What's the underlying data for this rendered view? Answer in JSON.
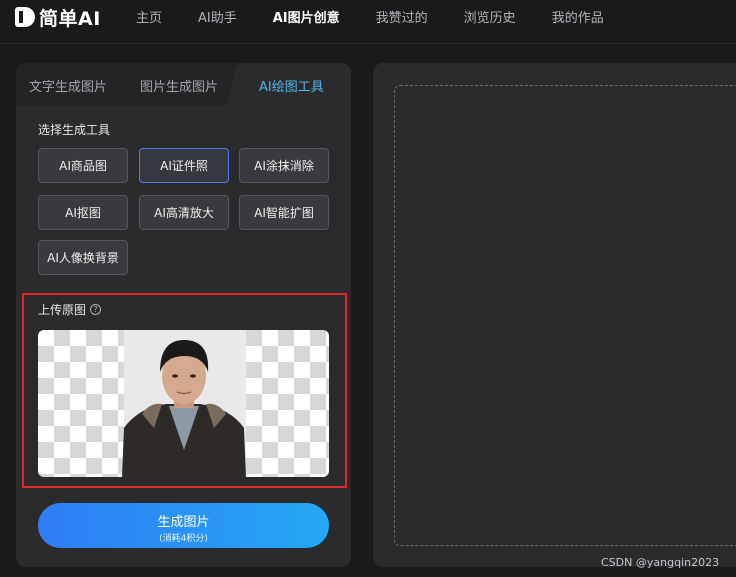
{
  "logo": {
    "text": "简单AI"
  },
  "nav": [
    "主页",
    "AI助手",
    "AI图片创意",
    "我赞过的",
    "浏览历史",
    "我的作品"
  ],
  "nav_active": "AI图片创意",
  "tabs": [
    "文字生成图片",
    "图片生成图片",
    "AI绘图工具"
  ],
  "tabs_active": "AI绘图工具",
  "tool_section_label": "选择生成工具",
  "tools": [
    "AI商品图",
    "AI证件照",
    "AI涂抹消除",
    "AI抠图",
    "AI高清放大",
    "AI智能扩图",
    "AI人像换背景"
  ],
  "tools_selected": "AI证件照",
  "upload": {
    "label": "上传原图",
    "help": "?"
  },
  "generate": {
    "label": "生成图片",
    "cost": "(消耗4积分)"
  },
  "watermark": "CSDN @yangqin2023",
  "colors": {
    "accent": "#4fb4e8",
    "highlight_border": "#e0282a",
    "button_gradient_start": "#2f7df7",
    "button_gradient_end": "#23a8f2"
  }
}
